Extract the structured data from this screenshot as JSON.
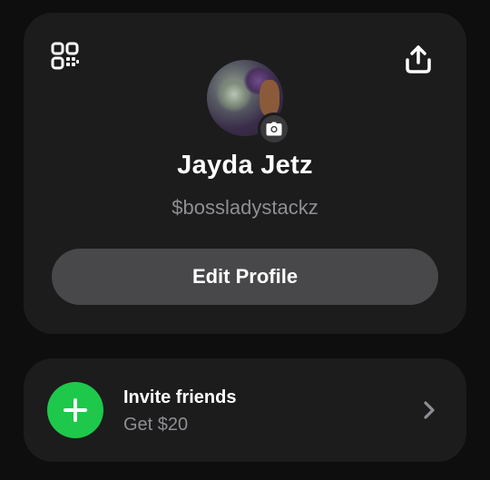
{
  "profile": {
    "name": "Jayda Jetz",
    "cashtag": "$bossladystackz",
    "edit_button_label": "Edit Profile"
  },
  "icons": {
    "qr": "qr-code-icon",
    "share": "share-icon",
    "camera": "camera-icon",
    "plus": "plus-icon",
    "chevron": "chevron-right-icon"
  },
  "invite": {
    "title": "Invite friends",
    "subtitle": "Get $20"
  },
  "colors": {
    "background": "#0e0e0e",
    "card": "#1c1c1d",
    "button": "#48484a",
    "accent_green": "#1ec84b",
    "secondary_text": "#8e8e93"
  }
}
